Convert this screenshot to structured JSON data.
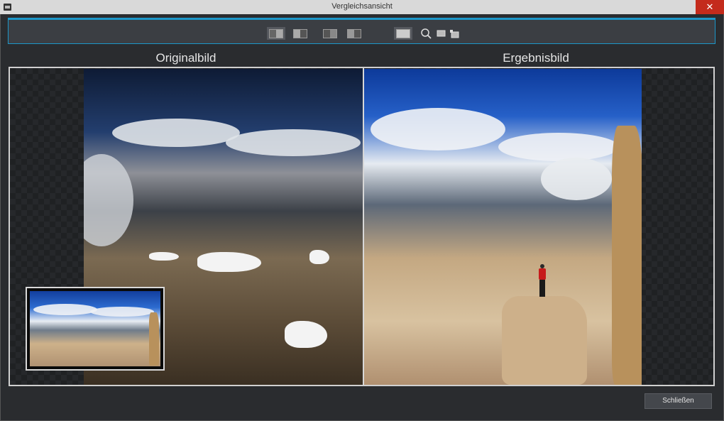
{
  "window": {
    "title": "Vergleichsansicht",
    "close_glyph": "✕"
  },
  "toolbar": {
    "buttons": [
      {
        "name": "split-vertical",
        "icon": "split-vertical-icon"
      },
      {
        "name": "split-vertical-alt",
        "icon": "split-vertical-alt-icon"
      },
      {
        "name": "split-horizontal",
        "icon": "split-horizontal-icon"
      },
      {
        "name": "split-horizontal-alt",
        "icon": "split-horizontal-alt-icon"
      },
      {
        "name": "single-view",
        "icon": "single-view-icon"
      },
      {
        "name": "zoom",
        "icon": "magnifier-icon"
      },
      {
        "name": "fit-view",
        "icon": "fit-view-icon"
      },
      {
        "name": "actual-size",
        "icon": "actual-size-icon"
      }
    ]
  },
  "panes": {
    "original_label": "Originalbild",
    "result_label": "Ergebnisbild"
  },
  "footer": {
    "close_label": "Schließen"
  },
  "colors": {
    "accent": "#1c97c9",
    "close_red": "#c42b1c"
  }
}
